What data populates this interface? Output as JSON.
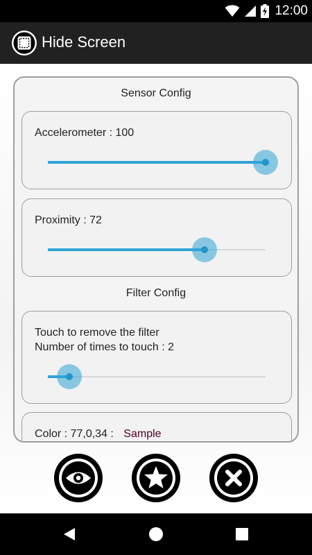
{
  "status_bar": {
    "time": "12:00",
    "icons": [
      "wifi-icon",
      "signal-icon",
      "battery-charging-icon"
    ]
  },
  "app_bar": {
    "title": "Hide Screen",
    "icon": "app-logo-icon"
  },
  "sensor_config": {
    "title": "Sensor Config",
    "accelerometer": {
      "label": "Accelerometer : 100",
      "value": 100,
      "max": 100
    },
    "proximity": {
      "label": "Proximity : 72",
      "value": 72,
      "max": 100
    }
  },
  "filter_config": {
    "title": "Filter Config",
    "touch": {
      "line1": "Touch to remove the filter",
      "line2": "Number of times to touch : 2",
      "value": 2,
      "max": 20
    },
    "color": {
      "label": "Color : 77,0,34 :",
      "sample": "Sample",
      "sample_color": "#4d0022"
    }
  },
  "actions": [
    "eye-icon",
    "star-icon",
    "close-icon"
  ],
  "nav": [
    "back-icon",
    "home-icon",
    "recents-icon"
  ],
  "colors": {
    "accent": "#2fa4d6",
    "toolbar": "#212121"
  }
}
